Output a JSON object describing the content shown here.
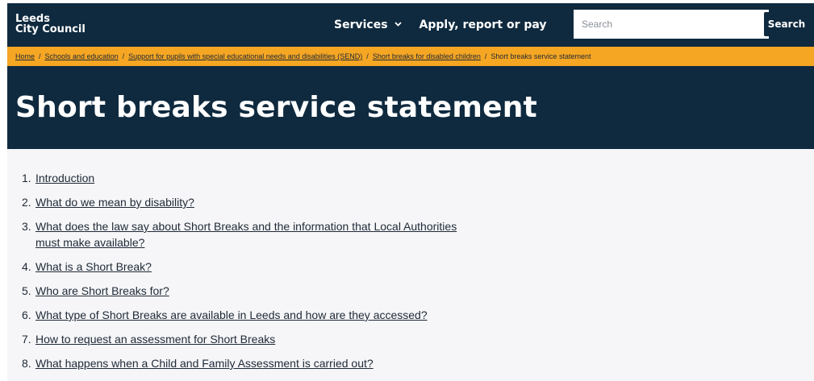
{
  "header": {
    "logo_line1": "Leeds",
    "logo_line2": "City Council",
    "nav": [
      {
        "label": "Services",
        "has_dropdown": true
      },
      {
        "label": "Apply, report or pay"
      }
    ],
    "search": {
      "placeholder": "Search",
      "button_label": "Search"
    }
  },
  "breadcrumb": [
    "Home",
    "Schools and education",
    "Support for pupils with special educational needs and disabilities (SEND)",
    "Short breaks for disabled children",
    "Short breaks service statement"
  ],
  "page_title": "Short breaks service statement",
  "toc": [
    {
      "num": "1.",
      "label": "Introduction"
    },
    {
      "num": "2.",
      "label": "What do we mean by disability?"
    },
    {
      "num": "3.",
      "label": "What does the law say about Short Breaks and the information that Local Authorities must make available?"
    },
    {
      "num": "4.",
      "label": "What is a Short Break?"
    },
    {
      "num": "5.",
      "label": "Who are Short Breaks for?"
    },
    {
      "num": "6.",
      "label": "What type of Short Breaks are available in Leeds and how are they accessed?"
    },
    {
      "num": "7.",
      "label": "How to request an assessment for Short Breaks"
    },
    {
      "num": "8.",
      "label": "What happens when a Child and Family Assessment is carried out?"
    }
  ],
  "colors": {
    "navy": "#0f2a3f",
    "breadcrumb_bg": "#f5a623"
  },
  "icons": {
    "dropdown": "chevron-down-icon"
  }
}
